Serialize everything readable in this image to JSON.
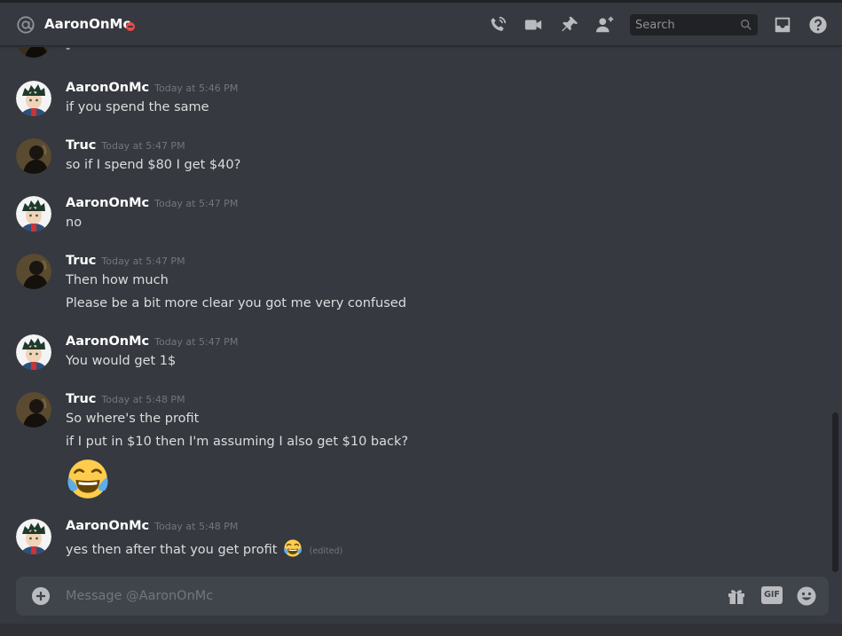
{
  "header": {
    "channel_name": "AaronOnMc",
    "search_placeholder": "Search"
  },
  "messages": {
    "m0": {
      "line1": "-"
    },
    "m1": {
      "author": "AaronOnMc",
      "timestamp": "Today at 5:46 PM",
      "line1": "if you spend the same"
    },
    "m2": {
      "author": "Truc",
      "timestamp": "Today at 5:47 PM",
      "line1": "so if I spend $80 I get $40?"
    },
    "m3": {
      "author": "AaronOnMc",
      "timestamp": "Today at 5:47 PM",
      "line1": "no"
    },
    "m4": {
      "author": "Truc",
      "timestamp": "Today at 5:47 PM",
      "line1": "Then how much",
      "line2": "Please be a bit more clear you got me very confused"
    },
    "m5": {
      "author": "AaronOnMc",
      "timestamp": "Today at 5:47 PM",
      "line1": "You would get 1$"
    },
    "m6": {
      "author": "Truc",
      "timestamp": "Today at 5:48 PM",
      "line1": "So where's the profit",
      "line2": "if I put in $10 then I'm assuming I also get $10 back?"
    },
    "m7": {
      "author": "AaronOnMc",
      "timestamp": "Today at 5:48 PM",
      "line1": "yes then after that you get profit",
      "edited": "(edited)"
    }
  },
  "composer": {
    "placeholder": "Message @AaronOnMc",
    "gif_label": "GIF"
  },
  "colors": {
    "background": "#36393f",
    "dnd_status": "#f04747",
    "timestamp": "#72767d",
    "composer_bg": "#40444b"
  },
  "icons": [
    "at-icon",
    "dnd-status-icon",
    "voice-call-icon",
    "video-call-icon",
    "pin-icon",
    "add-friend-icon",
    "search-icon",
    "inbox-icon",
    "help-icon",
    "plus-icon",
    "gift-icon",
    "gif-icon",
    "emoji-icon",
    "joy-emoji"
  ]
}
